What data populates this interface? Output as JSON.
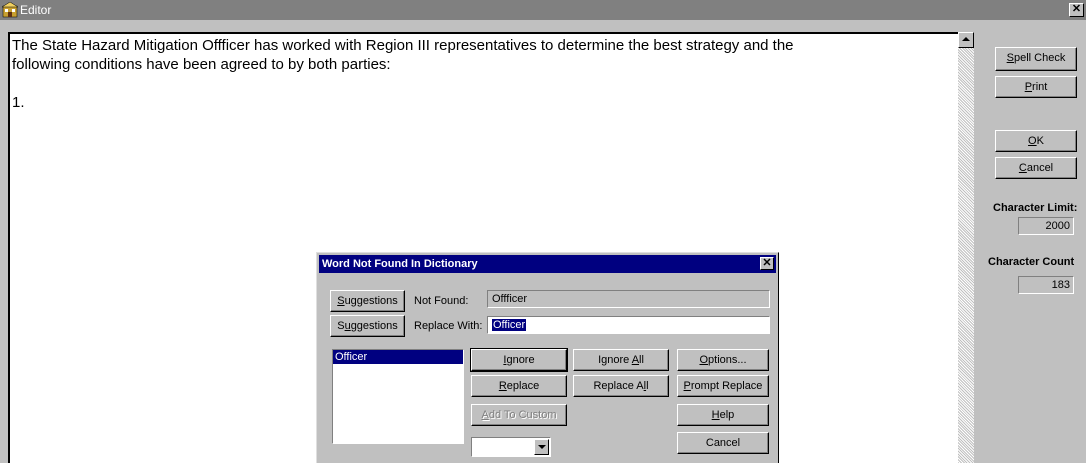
{
  "window": {
    "title": "Editor",
    "close_glyph": "✕"
  },
  "document": {
    "lines": [
      "The State Hazard Mitigation Offficer has worked with Region III representatives to determine the best strategy and the",
      "following conditions have been agreed to by both parties:",
      "1."
    ]
  },
  "side": {
    "spell_check": {
      "pre": "",
      "key": "S",
      "post": "pell Check"
    },
    "print": {
      "pre": "",
      "key": "P",
      "post": "rint"
    },
    "ok": {
      "pre": "",
      "key": "O",
      "post": "K"
    },
    "cancel": {
      "pre": "",
      "key": "C",
      "post": "ancel"
    },
    "char_limit_label": "Character Limit:",
    "char_limit_value": "2000",
    "char_count_label": "Character Count",
    "char_count_value": "183"
  },
  "dialog": {
    "title": "Word Not Found In Dictionary",
    "close_glyph": "✕",
    "suggestions1": {
      "pre": "",
      "key": "S",
      "post": "uggestions"
    },
    "suggestions2": {
      "pre": "S",
      "key": "u",
      "post": "ggestions"
    },
    "not_found_label": "Not Found:",
    "not_found_value": "Offficer",
    "replace_with_label": "Replace With:",
    "replace_with_value": "Officer",
    "list": [
      "Officer"
    ],
    "ignore": {
      "pre": "",
      "key": "I",
      "post": "gnore"
    },
    "ignore_all": {
      "pre": "Ignore ",
      "key": "A",
      "post": "ll"
    },
    "options": {
      "pre": "",
      "key": "O",
      "post": "ptions..."
    },
    "replace": {
      "pre": "",
      "key": "R",
      "post": "eplace"
    },
    "replace_all": {
      "pre": "Replace A",
      "key": "l",
      "post": "l"
    },
    "prompt_replace": {
      "pre": "",
      "key": "P",
      "post": "rompt Replace"
    },
    "add_to_custom": {
      "pre": "",
      "key": "A",
      "post": "dd To Custom"
    },
    "help": {
      "pre": "",
      "key": "H",
      "post": "elp"
    },
    "cancel_label": "Cancel",
    "combo_value": ""
  },
  "colors": {
    "dialog_title_bg": "#000080",
    "window_title_bg": "#808080",
    "face": "#c0c0c0",
    "selection": "#000080"
  },
  "icons": {
    "window_icon": "editor-app-icon",
    "scroll_up": "up-arrow-icon",
    "combo_drop": "down-arrow-icon"
  }
}
